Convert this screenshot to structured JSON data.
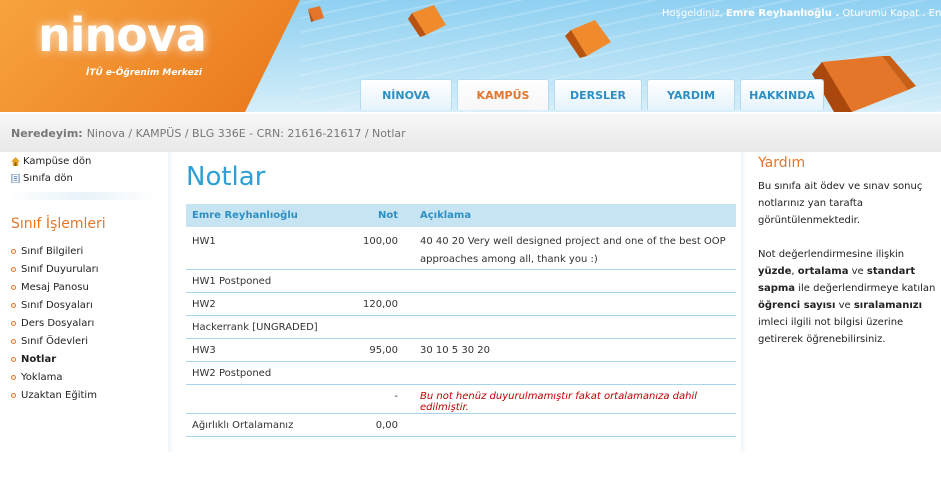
{
  "header": {
    "logo": "ninova",
    "logo_sub": "İTÜ e-Öğrenim Merkezi",
    "welcome_prefix": "Hoşgeldiniz,",
    "user_name": "Emre Reyhanlıoğlu .",
    "logout": "Oturumu Kapat .",
    "lang": "En",
    "tabs": [
      "NİNOVA",
      "KAMPÜS",
      "DERSLER",
      "YARDIM",
      "HAKKINDA"
    ],
    "active_tab": "KAMPÜS"
  },
  "breadcrumb": {
    "label": "Neredeyim:",
    "path": "Ninova / KAMPÜS / BLG 336E - CRN: 21616-21617 / Notlar"
  },
  "sidebar": {
    "back_campus": "Kampüse dön",
    "back_class": "Sınıfa dön",
    "section_title": "Sınıf İşlemleri",
    "items": [
      "Sınıf Bilgileri",
      "Sınıf Duyuruları",
      "Mesaj Panosu",
      "Sınıf Dosyaları",
      "Ders Dosyaları",
      "Sınıf Ödevleri",
      "Notlar",
      "Yoklama",
      "Uzaktan Eğitim"
    ],
    "active_item": "Notlar"
  },
  "main": {
    "title": "Notlar",
    "columns": [
      "Emre Reyhanlıoğlu",
      "Not",
      "Açıklama"
    ],
    "rows": [
      {
        "name": "HW1",
        "grade": "100,00",
        "desc": "40 40 20 Very well designed project and one of the best OOP approaches among all, thank you :)"
      },
      {
        "name": "HW1 Postponed",
        "grade": "",
        "desc": ""
      },
      {
        "name": "HW2",
        "grade": "120,00",
        "desc": ""
      },
      {
        "name": "Hackerrank [UNGRADED]",
        "grade": "",
        "desc": ""
      },
      {
        "name": "HW3",
        "grade": "95,00",
        "desc": "30 10 5 30 20"
      },
      {
        "name": "HW2 Postponed",
        "grade": "",
        "desc": ""
      },
      {
        "name": "",
        "grade": "-",
        "desc": "Bu not henüz duyurulmamıştır fakat ortalamanıza dahil edilmiştir."
      },
      {
        "name": "Ağırlıklı Ortalamanız",
        "grade": "0,00",
        "desc": ""
      }
    ]
  },
  "help": {
    "title": "Yardım",
    "p1": "Bu sınıfa ait ödev ve sınav sonuç notlarınız yan tarafta görüntülenmektedir.",
    "p2_a": "Not değerlendirmesine ilişkin ",
    "p2_b": "yüzde",
    "p2_c": ", ",
    "p2_d": "ortalama",
    "p2_e": " ve ",
    "p2_f": "standart sapma",
    "p2_g": " ile değerlendirmeye katılan ",
    "p2_h": "öğrenci sayısı",
    "p2_i": " ve ",
    "p2_j": "sıralamanızı",
    "p2_k": " imleci ilgili not bilgisi üzerine getirerek öğrenebilirsiniz."
  },
  "colors": {
    "accent_orange": "#e4762a",
    "accent_blue": "#2f9fd6",
    "note_red": "#c00000"
  }
}
